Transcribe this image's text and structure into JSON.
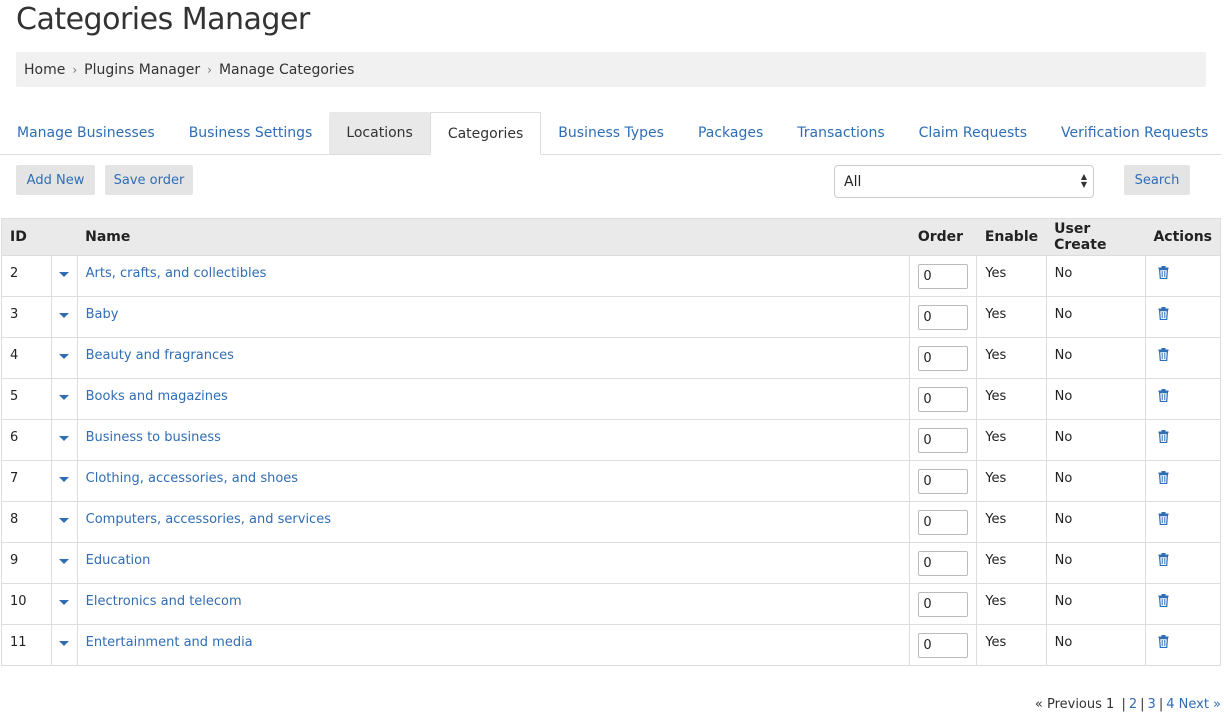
{
  "page": {
    "title": "Categories Manager"
  },
  "breadcrumb": [
    "Home",
    "Plugins Manager",
    "Manage Categories"
  ],
  "tabs": [
    {
      "label": "Manage Businesses"
    },
    {
      "label": "Business Settings"
    },
    {
      "label": "Locations"
    },
    {
      "label": "Categories"
    },
    {
      "label": "Business Types"
    },
    {
      "label": "Packages"
    },
    {
      "label": "Transactions"
    },
    {
      "label": "Claim Requests"
    },
    {
      "label": "Verification Requests"
    }
  ],
  "toolbar": {
    "add_new": "Add New",
    "save_order": "Save order",
    "filter_value": "All",
    "search": "Search"
  },
  "table": {
    "headers": {
      "id": "ID",
      "name": "Name",
      "order": "Order",
      "enable": "Enable",
      "user_create": "User Create",
      "actions": "Actions"
    },
    "rows": [
      {
        "id": "2",
        "name": "Arts, crafts, and collectibles",
        "order": "0",
        "enable": "Yes",
        "user_create": "No"
      },
      {
        "id": "3",
        "name": "Baby",
        "order": "0",
        "enable": "Yes",
        "user_create": "No"
      },
      {
        "id": "4",
        "name": "Beauty and fragrances",
        "order": "0",
        "enable": "Yes",
        "user_create": "No"
      },
      {
        "id": "5",
        "name": "Books and magazines",
        "order": "0",
        "enable": "Yes",
        "user_create": "No"
      },
      {
        "id": "6",
        "name": "Business to business",
        "order": "0",
        "enable": "Yes",
        "user_create": "No"
      },
      {
        "id": "7",
        "name": "Clothing, accessories, and shoes",
        "order": "0",
        "enable": "Yes",
        "user_create": "No"
      },
      {
        "id": "8",
        "name": "Computers, accessories, and services",
        "order": "0",
        "enable": "Yes",
        "user_create": "No"
      },
      {
        "id": "9",
        "name": "Education",
        "order": "0",
        "enable": "Yes",
        "user_create": "No"
      },
      {
        "id": "10",
        "name": "Electronics and telecom",
        "order": "0",
        "enable": "Yes",
        "user_create": "No"
      },
      {
        "id": "11",
        "name": "Entertainment and media",
        "order": "0",
        "enable": "Yes",
        "user_create": "No"
      }
    ]
  },
  "pagination": {
    "previous": "« Previous",
    "current": "1",
    "pages": [
      "2",
      "3",
      "4"
    ],
    "next": "Next »"
  },
  "colors": {
    "link": "#2f6db5",
    "header_bg": "#eaeaea",
    "button_bg": "#e4e4e4"
  },
  "icons": {
    "delete": "trash-icon",
    "expand": "caret-down-icon",
    "breadcrumb_separator": "chevron-right-icon",
    "select": "select-arrows-icon"
  }
}
